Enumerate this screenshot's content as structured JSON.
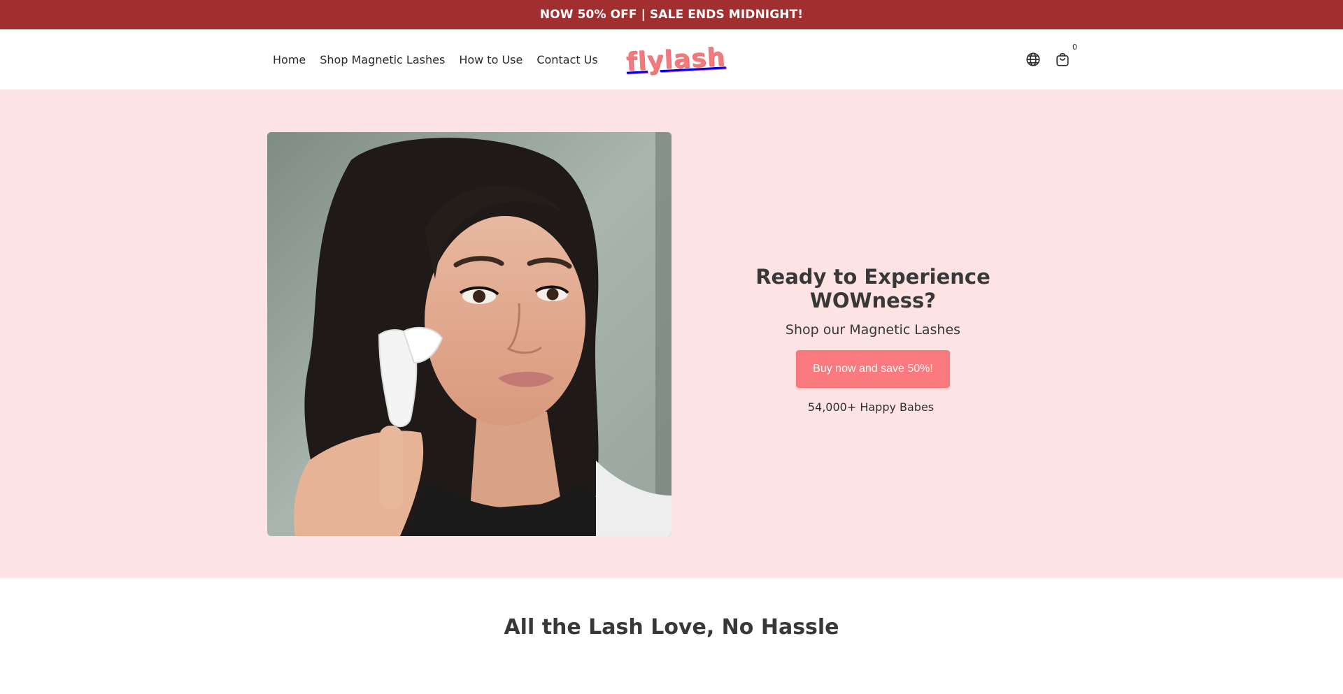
{
  "announcement": {
    "text": "NOW 50% OFF | SALE ENDS MIDNIGHT!"
  },
  "nav": {
    "items": [
      {
        "label": "Home"
      },
      {
        "label": "Shop Magnetic Lashes"
      },
      {
        "label": "How to Use"
      },
      {
        "label": "Contact Us"
      }
    ]
  },
  "logo": {
    "text": "flylash"
  },
  "header_icons": {
    "globe_icon": "globe-icon",
    "cart_icon": "shopping-bag-icon",
    "cart_count": "0"
  },
  "hero": {
    "image_alt": "woman holding magnetic lash applicator",
    "title": "Ready to Experience WOWness?",
    "subtitle": "Shop our Magnetic Lashes",
    "button_label": "Buy now and save 50%!",
    "note": "54,000+ Happy Babes"
  },
  "section": {
    "title": "All the Lash Love, No Hassle"
  },
  "colors": {
    "announcement_bg": "#a22f2f",
    "hero_bg": "#fde3e3",
    "button_bg": "#fa797e",
    "logo": "#f27a7d"
  }
}
